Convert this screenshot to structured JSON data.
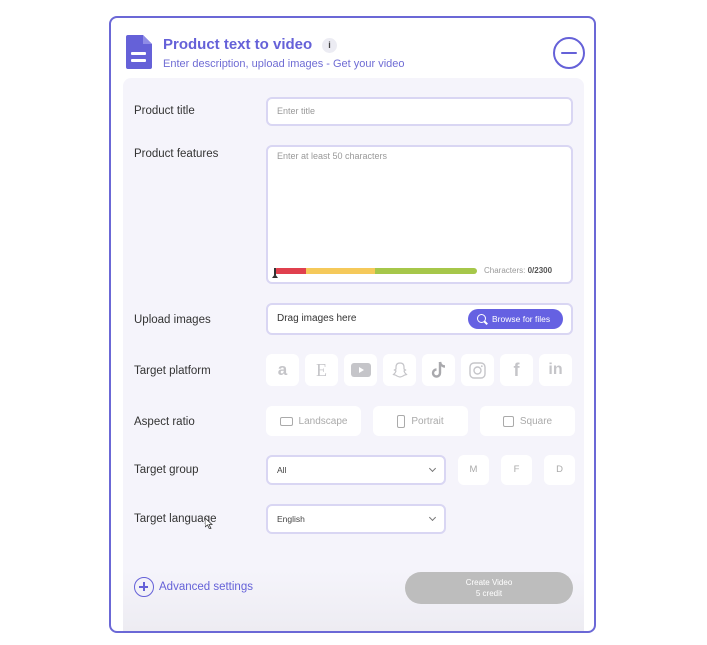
{
  "header": {
    "title": "Product text to video",
    "info_icon": "i",
    "subtitle": "Enter description, upload images - Get your video"
  },
  "form": {
    "product_title": {
      "label": "Product title",
      "placeholder": "Enter title",
      "value": ""
    },
    "product_features": {
      "label": "Product features",
      "placeholder": "Enter at least 50 characters",
      "value": "",
      "characters_label": "Characters:",
      "characters_count": "0/2300",
      "progress_fraction": 0,
      "quality_bar_colors": [
        "#e0404e",
        "#f5c95a",
        "#a6c74a"
      ]
    },
    "upload_images": {
      "label": "Upload images",
      "drop_text": "Drag images here",
      "browse_label": "Browse for files"
    },
    "target_platform": {
      "label": "Target platform",
      "platforms": [
        {
          "name": "amazon",
          "glyph": "a"
        },
        {
          "name": "etsy",
          "glyph": "E"
        },
        {
          "name": "youtube",
          "glyph": "▶"
        },
        {
          "name": "snapchat",
          "glyph": "👻"
        },
        {
          "name": "tiktok",
          "glyph": "♪"
        },
        {
          "name": "instagram",
          "glyph": "◎"
        },
        {
          "name": "facebook",
          "glyph": "f"
        },
        {
          "name": "linkedin",
          "glyph": "in"
        }
      ]
    },
    "aspect_ratio": {
      "label": "Aspect ratio",
      "options": [
        "Landscape",
        "Portrait",
        "Square"
      ]
    },
    "target_group": {
      "label": "Target group",
      "selected": "All",
      "genders": [
        "M",
        "F",
        "D"
      ]
    },
    "target_language": {
      "label": "Target language",
      "selected": "English"
    }
  },
  "footer": {
    "advanced_settings": "Advanced settings",
    "create_button_line1": "Create Video",
    "create_button_line2": "5 credit"
  },
  "colors": {
    "accent": "#6561d8",
    "button_disabled": "#bdbdbd",
    "field_border": "#d9d6f3"
  }
}
